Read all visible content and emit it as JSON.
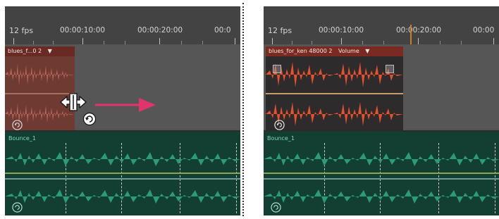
{
  "left_panel": {
    "fps_label": "12 fps",
    "timecodes": [
      "00:00:10:00",
      "00:00:20:00",
      "00:0"
    ],
    "clip_title": "blues_f...0 2",
    "clip_menu_arrow": "▼",
    "bounce_track_name": "Bounce_1"
  },
  "right_panel": {
    "fps_label": "12 fps",
    "timecodes": [
      "00:00:10:00",
      "00:00:20:00",
      "00:00"
    ],
    "clip_title": "blues_for_ken 48000 2",
    "clip_param": "Volume",
    "clip_menu_arrow": "▼",
    "bounce_track_name": "Bounce_1"
  },
  "colors": {
    "orange_clip_dim": "#8c4438",
    "orange_clip_bright": "#e8502e",
    "green_clip": "#2a9c7a",
    "arrow": "#e0346b",
    "playhead": "#c9802d"
  },
  "icons": {
    "resize_cursor": "horizontal-resize-cursor-icon",
    "loop": "loop-icon",
    "drag_arrow": "right-arrow-icon"
  }
}
